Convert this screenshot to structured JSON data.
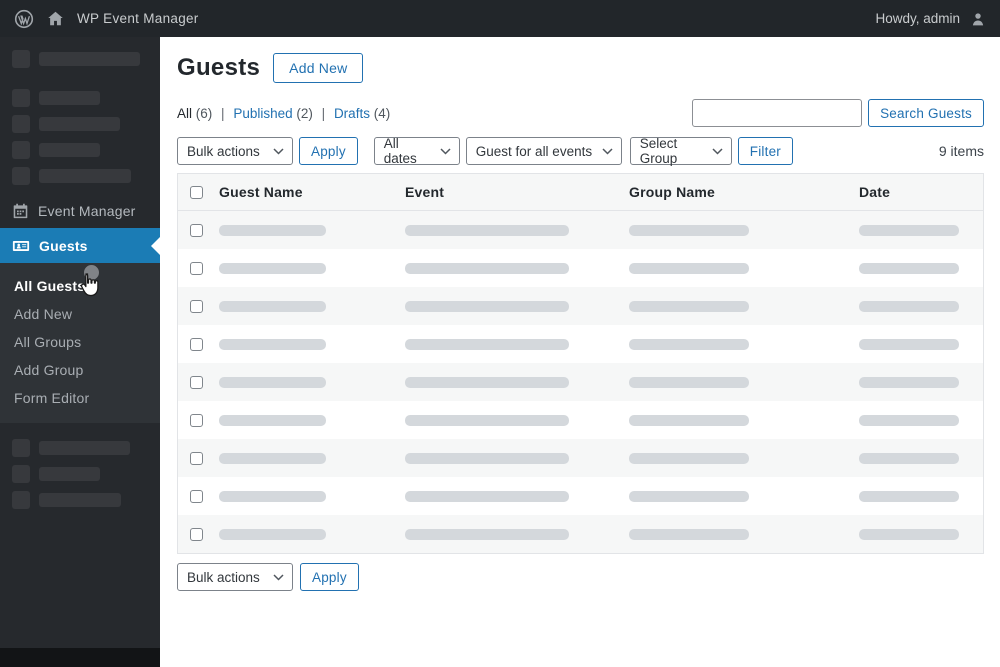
{
  "admin_bar": {
    "site_name": "WP Event Manager",
    "howdy": "Howdy, admin"
  },
  "sidebar": {
    "event_manager_label": "Event Manager",
    "guests_label": "Guests",
    "submenu": [
      {
        "label": "All Guests"
      },
      {
        "label": "Add New"
      },
      {
        "label": "All Groups"
      },
      {
        "label": "Add Group"
      },
      {
        "label": "Form Editor"
      }
    ]
  },
  "page": {
    "title": "Guests",
    "add_new_label": "Add New",
    "views": {
      "separator": "|",
      "items": [
        {
          "label": "All",
          "count": "(6)"
        },
        {
          "label": "Published",
          "count": "(2)"
        },
        {
          "label": "Drafts",
          "count": "(4)"
        }
      ]
    },
    "search": {
      "value": "",
      "placeholder": "",
      "button_label": "Search Guests"
    },
    "filters": {
      "bulk_actions_label": "Bulk actions",
      "apply_label": "Apply",
      "all_dates_label": "All dates",
      "event_filter_label": "Guest for all events",
      "group_filter_label": "Select Group",
      "filter_label": "Filter",
      "items_count": "9 items"
    },
    "table": {
      "columns": [
        "Guest Name",
        "Event",
        "Group Name",
        "Date"
      ],
      "row_count": 9
    },
    "bottom": {
      "bulk_actions_label": "Bulk actions",
      "apply_label": "Apply"
    }
  },
  "icons": {
    "wordpress_logo": "wordpress-logo-icon",
    "home": "home-icon",
    "user": "user-avatar-icon",
    "calendar": "calendar-icon",
    "id_card": "id-card-icon",
    "chevron": "chevron-down-icon",
    "hand_cursor": "hand-cursor-icon",
    "click_indicator": "click-indicator"
  },
  "colors": {
    "accent_blue": "#2271b1",
    "menu_highlight_blue": "#1b7cb5",
    "admin_bar_bg": "#22262a",
    "sidebar_bg": "#26292d",
    "submenu_bg": "#2f3337",
    "row_alt_bg": "#f6f7f7",
    "placeholder_bar": "#d4d8dc"
  }
}
